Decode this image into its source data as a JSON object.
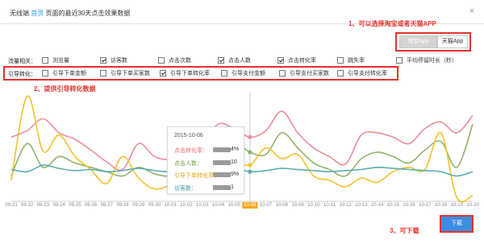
{
  "header": {
    "title_prefix": "无线端",
    "title_link": "首页",
    "title_suffix": "页面的最近30天点击效果数据",
    "close_glyph": "×"
  },
  "annotations": {
    "app_note": "1、可以选择淘宝或者天猫APP",
    "conv_note": "2、提供引导转化数据",
    "download_note": "3、可下载"
  },
  "app_switch": {
    "options": [
      "淘宝App",
      "天猫App"
    ],
    "selected": 0
  },
  "filters": {
    "traffic_label": "流量相关：",
    "traffic": [
      {
        "label": "浏览量",
        "checked": false
      },
      {
        "label": "访客数",
        "checked": true
      },
      {
        "label": "点击次数",
        "checked": false
      },
      {
        "label": "点击人数",
        "checked": true
      },
      {
        "label": "点击转化率",
        "checked": true
      },
      {
        "label": "跳失率",
        "checked": false
      },
      {
        "label": "平均停留时长（秒）",
        "checked": false
      }
    ],
    "conv_label": "引导转化：",
    "conversion": [
      {
        "label": "引导下单金额",
        "checked": false
      },
      {
        "label": "引导下单买家数",
        "checked": false
      },
      {
        "label": "引导下单转化率",
        "checked": true
      },
      {
        "label": "引导支付金额",
        "checked": false
      },
      {
        "label": "引导支付买家数",
        "checked": false
      },
      {
        "label": "引导支付转化率",
        "checked": false
      }
    ]
  },
  "chart_data": {
    "type": "line",
    "x": [
      "09-21",
      "09-22",
      "09-23",
      "09-24",
      "09-25",
      "09-26",
      "09-27",
      "09-28",
      "09-29",
      "09-30",
      "10-01",
      "10-02",
      "10-03",
      "10-04",
      "10-05",
      "10-06",
      "10-07",
      "10-08",
      "10-09",
      "10-10",
      "10-11",
      "10-12",
      "10-13",
      "10-14",
      "10-15",
      "10-16",
      "10-17",
      "10-18",
      "10-19",
      "10-20"
    ],
    "x_tick_labels": [
      "09-21",
      "09-22",
      "09-23",
      "09-24",
      "09-25",
      "09-26",
      "09-27",
      "09-28",
      "09-29",
      "09-30",
      "10-01",
      "10-02",
      "10-03",
      "10-04",
      "10-05",
      "10-06",
      "10-07",
      "10-08",
      "10-09",
      "10-10",
      "10-11",
      "10-12",
      "10-13",
      "10-14",
      "10-15",
      "10-16",
      "10-17",
      "10-18",
      "10-19",
      "10-20"
    ],
    "selected_x": "10-06",
    "ylim": [
      0,
      100
    ],
    "grid": false,
    "series": [
      {
        "name": "点击转化率",
        "color": "#e98f9a",
        "values": [
          58,
          64,
          75,
          62,
          56,
          46,
          35,
          28,
          52,
          40,
          38,
          50,
          52,
          70,
          66,
          58,
          64,
          82,
          62,
          48,
          40,
          33,
          60,
          62,
          58,
          52,
          66,
          72,
          62,
          78
        ]
      },
      {
        "name": "点击人数",
        "color": "#8eb56a",
        "values": [
          22,
          52,
          30,
          40,
          34,
          30,
          26,
          22,
          30,
          24,
          22,
          28,
          32,
          50,
          54,
          44,
          42,
          62,
          48,
          34,
          28,
          22,
          38,
          44,
          40,
          34,
          46,
          54,
          30,
          70
        ]
      },
      {
        "name": "引导下单转化率",
        "color": "#f2c12e",
        "values": [
          18,
          96,
          45,
          60,
          40,
          28,
          15,
          40,
          20,
          10,
          14,
          25,
          30,
          26,
          36,
          32,
          48,
          38,
          42,
          22,
          18,
          12,
          20,
          16,
          26,
          30,
          28,
          62,
          2,
          4
        ]
      },
      {
        "name": "访客数",
        "color": "#5aaeb4",
        "values": [
          28,
          26,
          32,
          29,
          27,
          28,
          26,
          27,
          29,
          27,
          26,
          28,
          29,
          28,
          29,
          26,
          27,
          29,
          28,
          27,
          26,
          27,
          28,
          30,
          29,
          28,
          27,
          26,
          22,
          26
        ]
      }
    ]
  },
  "tooltip": {
    "date": "2015-10-06",
    "rows": [
      {
        "label": "点击转化率：",
        "suffix": "4%",
        "color": "#e76a6a"
      },
      {
        "label": "点击人数：",
        "suffix": "10",
        "color": "#6e9a3a"
      },
      {
        "label": "引导下单转化率：",
        "suffix": "9%",
        "color": "#e4a50e"
      },
      {
        "label": "访客数：",
        "suffix": "1",
        "color": "#3e9aa4"
      }
    ]
  },
  "download": {
    "label": "下载"
  }
}
